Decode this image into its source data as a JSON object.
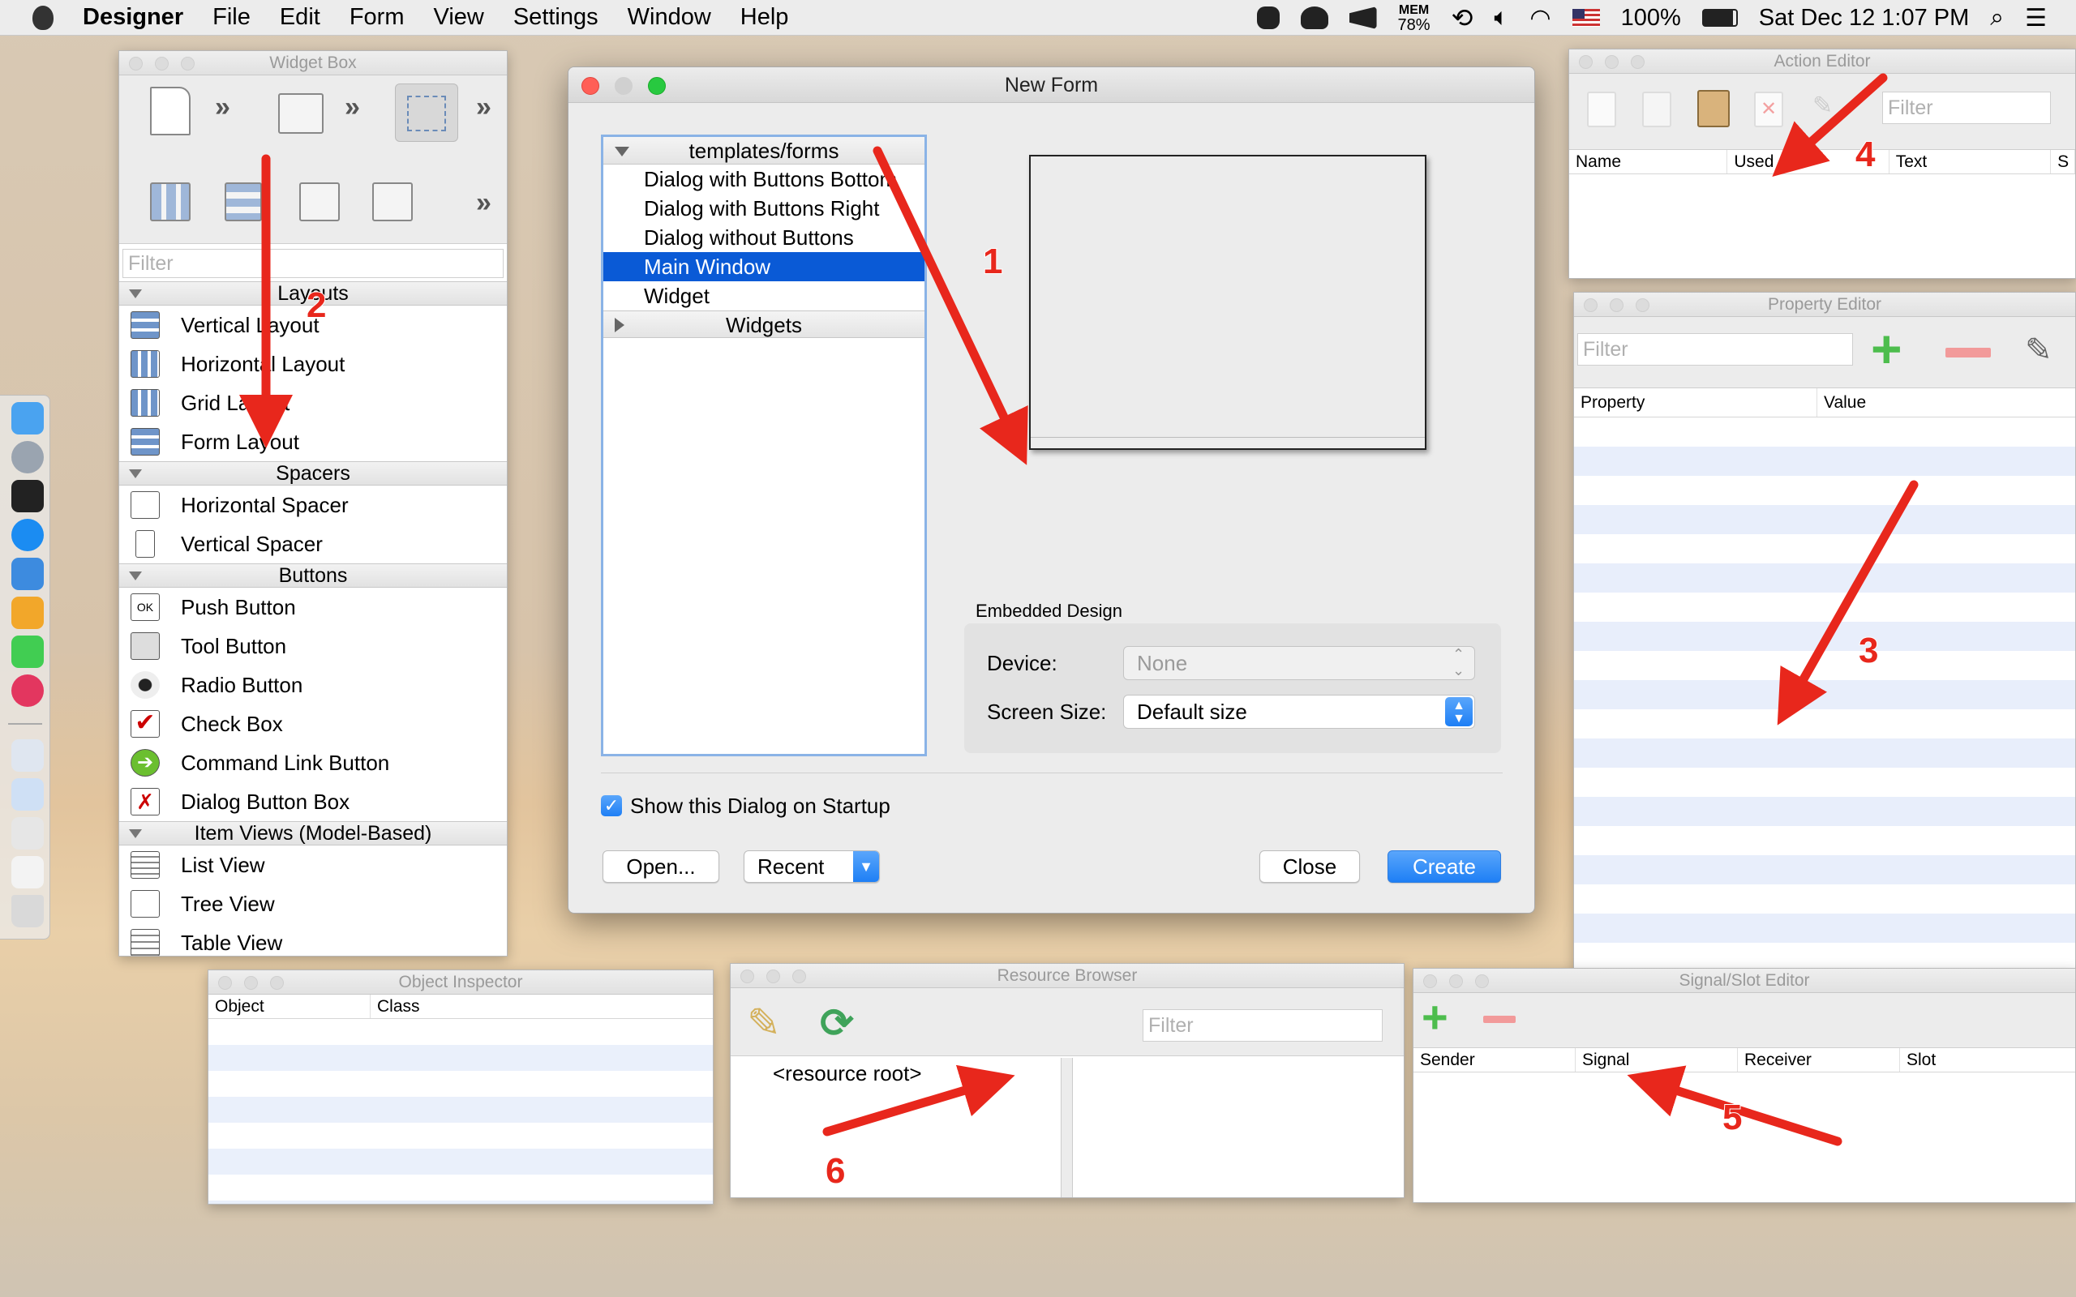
{
  "menubar": {
    "app_name": "Designer",
    "menus": [
      "File",
      "Edit",
      "Form",
      "View",
      "Settings",
      "Window",
      "Help"
    ],
    "mem_label": "MEM",
    "mem_value": "78%",
    "battery": "100%",
    "clock": "Sat Dec 12  1:07 PM"
  },
  "widget_box": {
    "title": "Widget Box",
    "filter_placeholder": "Filter",
    "categories": {
      "layouts": {
        "label": "Layouts",
        "items": [
          "Vertical Layout",
          "Horizontal Layout",
          "Grid Layout",
          "Form Layout"
        ]
      },
      "spacers": {
        "label": "Spacers",
        "items": [
          "Horizontal Spacer",
          "Vertical Spacer"
        ]
      },
      "buttons": {
        "label": "Buttons",
        "items": [
          "Push Button",
          "Tool Button",
          "Radio Button",
          "Check Box",
          "Command Link Button",
          "Dialog Button Box"
        ]
      },
      "item_views": {
        "label": "Item Views (Model-Based)",
        "items": [
          "List View",
          "Tree View",
          "Table View"
        ]
      }
    }
  },
  "new_form": {
    "title": "New Form",
    "tree": {
      "templates_label": "templates/forms",
      "templates": [
        "Dialog with Buttons Bottom",
        "Dialog with Buttons Right",
        "Dialog without Buttons",
        "Main Window",
        "Widget"
      ],
      "selected_index": 3,
      "widgets_label": "Widgets"
    },
    "embedded_design_label": "Embedded Design",
    "device_label": "Device:",
    "device_value": "None",
    "screen_size_label": "Screen Size:",
    "screen_size_value": "Default size",
    "show_on_startup_label": "Show this Dialog on Startup",
    "show_on_startup_checked": true,
    "open_button": "Open...",
    "recent_button": "Recent",
    "close_button": "Close",
    "create_button": "Create"
  },
  "action_editor": {
    "title": "Action Editor",
    "filter_placeholder": "Filter",
    "columns": [
      "Name",
      "Used",
      "Text",
      "S"
    ]
  },
  "property_editor": {
    "title": "Property Editor",
    "filter_placeholder": "Filter",
    "columns": [
      "Property",
      "Value"
    ]
  },
  "object_inspector": {
    "title": "Object Inspector",
    "columns": [
      "Object",
      "Class"
    ]
  },
  "resource_browser": {
    "title": "Resource Browser",
    "filter_placeholder": "Filter",
    "root_label": "<resource root>"
  },
  "signal_slot_editor": {
    "title": "Signal/Slot Editor",
    "columns": [
      "Sender",
      "Signal",
      "Receiver",
      "Slot"
    ]
  },
  "annotations": [
    "1",
    "2",
    "3",
    "4",
    "5",
    "6"
  ],
  "colors": {
    "arrow": "#e8271c",
    "selection": "#0a5ad6",
    "default_button": "#1e7ff5"
  }
}
